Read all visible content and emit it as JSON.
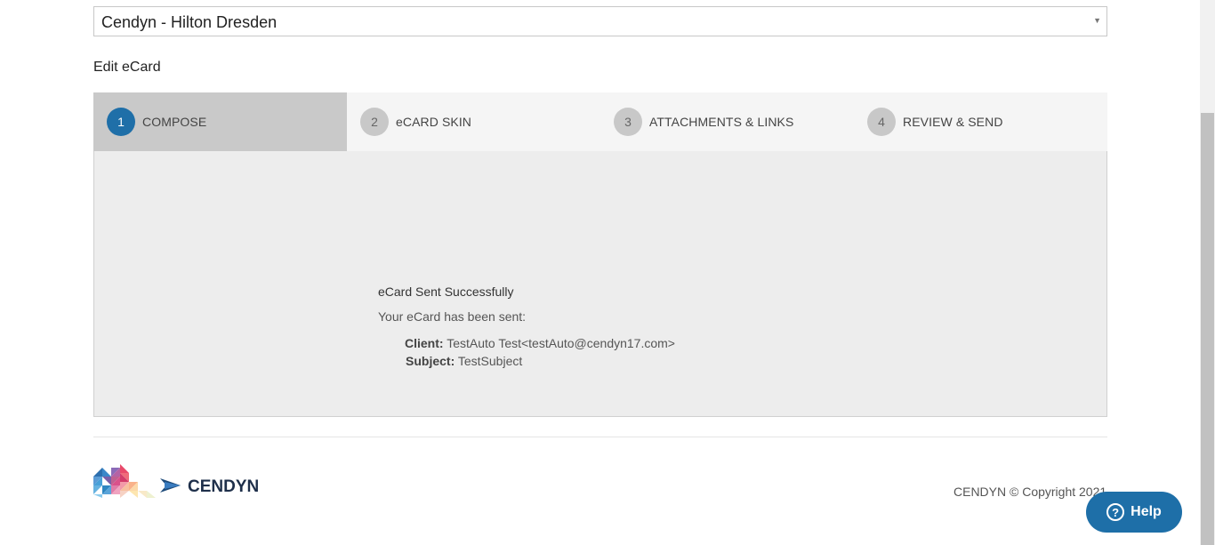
{
  "property_select": {
    "value": "Cendyn - Hilton Dresden",
    "arrow_icon": "caret-down-icon"
  },
  "page_title": "Edit eCard",
  "steps": [
    {
      "number": "1",
      "label": "COMPOSE",
      "active": true
    },
    {
      "number": "2",
      "label": "eCARD SKIN",
      "active": false
    },
    {
      "number": "3",
      "label": "ATTACHMENTS & LINKS",
      "active": false
    },
    {
      "number": "4",
      "label": "REVIEW & SEND",
      "active": false
    }
  ],
  "result": {
    "title": "eCard Sent Successfully",
    "subtitle": "Your eCard has been sent:",
    "client_label": "Client:",
    "client_value": "TestAuto Test<testAuto@cendyn17.com>",
    "subject_label": "Subject:",
    "subject_value": "TestSubject"
  },
  "footer": {
    "brand": "CENDYN",
    "copyright": "CENDYN © Copyright 2021"
  },
  "help": {
    "label": "Help",
    "icon": "question-circle-icon"
  },
  "colors": {
    "accent": "#1e6fa8",
    "active_step_bg": "#c9c9c9",
    "panel_bg": "#ededed"
  }
}
